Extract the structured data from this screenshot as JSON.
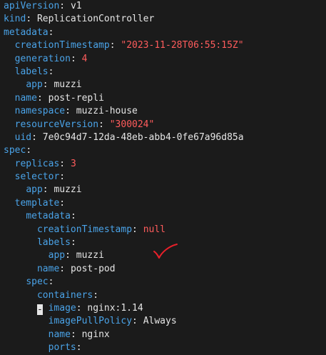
{
  "editor": {
    "lines": [
      {
        "indent": "",
        "key": "apiVersion",
        "value": "v1",
        "vtype": "val"
      },
      {
        "indent": "",
        "key": "kind",
        "value": "ReplicationController",
        "vtype": "val"
      },
      {
        "indent": "",
        "key": "metadata",
        "value": "",
        "vtype": "val"
      },
      {
        "indent": "  ",
        "key": "creationTimestamp",
        "value": "\"2023-11-28T06:55:15Z\"",
        "vtype": "str"
      },
      {
        "indent": "  ",
        "key": "generation",
        "value": "4",
        "vtype": "num"
      },
      {
        "indent": "  ",
        "key": "labels",
        "value": "",
        "vtype": "val"
      },
      {
        "indent": "    ",
        "key": "app",
        "value": "muzzi",
        "vtype": "val"
      },
      {
        "indent": "  ",
        "key": "name",
        "value": "post-repli",
        "vtype": "val"
      },
      {
        "indent": "  ",
        "key": "namespace",
        "value": "muzzi-house",
        "vtype": "val"
      },
      {
        "indent": "  ",
        "key": "resourceVersion",
        "value": "\"300024\"",
        "vtype": "str"
      },
      {
        "indent": "  ",
        "key": "uid",
        "value": "7e0c94d7-12da-48eb-abb4-0fe67a96d85a",
        "vtype": "val"
      },
      {
        "indent": "",
        "key": "spec",
        "value": "",
        "vtype": "val"
      },
      {
        "indent": "  ",
        "key": "replicas",
        "value": "3",
        "vtype": "num"
      },
      {
        "indent": "  ",
        "key": "selector",
        "value": "",
        "vtype": "val"
      },
      {
        "indent": "    ",
        "key": "app",
        "value": "muzzi",
        "vtype": "val"
      },
      {
        "indent": "  ",
        "key": "template",
        "value": "",
        "vtype": "val"
      },
      {
        "indent": "    ",
        "key": "metadata",
        "value": "",
        "vtype": "val"
      },
      {
        "indent": "      ",
        "key": "creationTimestamp",
        "value": "null",
        "vtype": "lit"
      },
      {
        "indent": "      ",
        "key": "labels",
        "value": "",
        "vtype": "val"
      },
      {
        "indent": "        ",
        "key": "app",
        "value": "muzzi",
        "vtype": "val"
      },
      {
        "indent": "      ",
        "key": "name",
        "value": "post-pod",
        "vtype": "val"
      },
      {
        "indent": "    ",
        "key": "spec",
        "value": "",
        "vtype": "val"
      },
      {
        "indent": "      ",
        "key": "containers",
        "value": "",
        "vtype": "val"
      },
      {
        "indent": "      ",
        "cursor": "-",
        "dash_after": " ",
        "key": "image",
        "value": "nginx:1.14",
        "vtype": "val"
      },
      {
        "indent": "        ",
        "key": "imagePullPolicy",
        "value": "Always",
        "vtype": "val"
      },
      {
        "indent": "        ",
        "key": "name",
        "value": "nginx",
        "vtype": "val"
      },
      {
        "indent": "        ",
        "key": "ports",
        "value": "",
        "vtype": "val"
      }
    ]
  },
  "colors": {
    "background": "#1b1b1b",
    "key": "#4aa3e8",
    "plain": "#e6e6e6",
    "string": "#ff5c5c",
    "checkmark": "#e8202a"
  },
  "annotation": {
    "icon": "checkmark-icon"
  }
}
